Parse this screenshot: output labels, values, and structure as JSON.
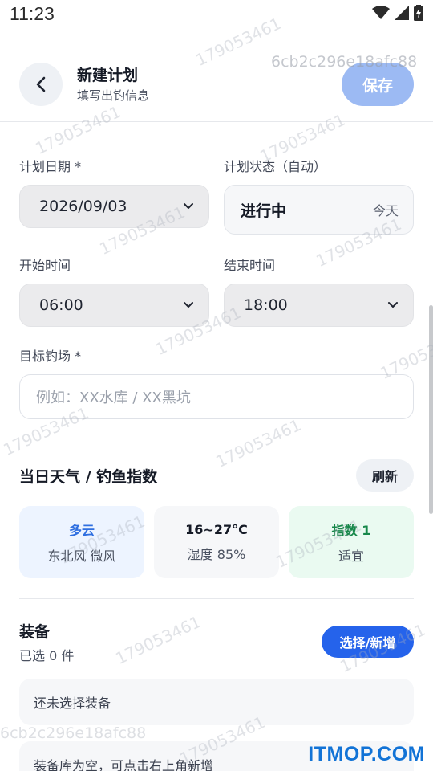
{
  "status_bar": {
    "time": "11:23"
  },
  "header": {
    "title": "新建计划",
    "subtitle": "填写出钓信息",
    "save_label": "保存"
  },
  "form": {
    "plan_date_label": "计划日期 *",
    "plan_date_value": "2026/09/03",
    "plan_status_label": "计划状态（自动）",
    "plan_status_value": "进行中",
    "plan_status_hint": "今天",
    "start_time_label": "开始时间",
    "start_time_value": "06:00",
    "end_time_label": "结束时间",
    "end_time_value": "18:00",
    "spot_label": "目标钓场 *",
    "spot_placeholder": "例如：XX水库 / XX黑坑"
  },
  "weather": {
    "section_title": "当日天气 / 钓鱼指数",
    "refresh_label": "刷新",
    "cards": [
      {
        "main": "多云",
        "sub": "东北风 微风",
        "color": "#2f6fe0",
        "bg": "#edf4ff"
      },
      {
        "main": "16~27°C",
        "sub": "湿度 85%",
        "color": "#151a26",
        "bg": "#f6f7f9"
      },
      {
        "main": "指数 1",
        "sub": "适宜",
        "color": "#17874a",
        "bg": "#eafaf1"
      }
    ]
  },
  "equipment": {
    "section_title": "装备",
    "count_text": "已选 0 件",
    "pick_label": "选择/新增",
    "empty_selected": "还未选择装备",
    "empty_library": "装备库为空，可点击右上角新增"
  },
  "watermark": {
    "id_text": "179053461",
    "hash_text": "6cb2c296e18afc88",
    "site_logo": "ITMOP.COM"
  },
  "colors": {
    "accent": "#2563eb",
    "save_disabled": "#9cbaf3"
  }
}
